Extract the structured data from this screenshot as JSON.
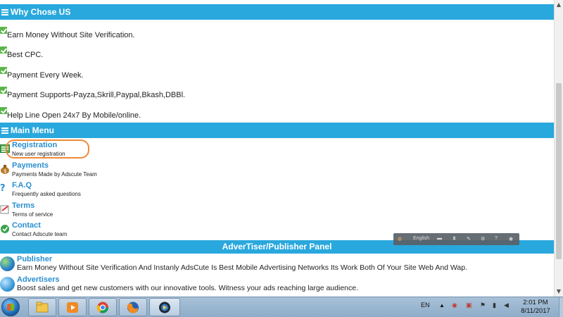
{
  "why_section": {
    "title": "Why Chose US",
    "items": [
      "Earn Money Without Site Verification.",
      "Best CPC.",
      "Payment Every Week.",
      "Payment Supports-Payza,Skrill,Paypal,Bkash,DBBl.",
      "Help Line Open 24x7 By Mobile/online."
    ]
  },
  "main_menu": {
    "title": "Main Menu",
    "items": [
      {
        "title": "Registration",
        "subtitle": "New user registration",
        "icon": "registration-icon"
      },
      {
        "title": "Payments",
        "subtitle": "Payments Made by Adscute Team",
        "icon": "money-bag-icon"
      },
      {
        "title": "F.A.Q",
        "subtitle": "Frequently asked questions",
        "icon": "question-icon"
      },
      {
        "title": "Terms",
        "subtitle": "Terms of service",
        "icon": "terms-icon"
      },
      {
        "title": "Contact",
        "subtitle": "Contact Adscute team",
        "icon": "contact-icon"
      }
    ]
  },
  "panel": {
    "title": "AdverTiser/Publisher Panel",
    "items": [
      {
        "title": "Publisher",
        "subtitle": "Earn Money Without Site Verification And Instanly AdsCute Is Best Mobile Advertising Networks Its Work Both Of Your Site Web And Wap.",
        "icon": "globe-icon"
      },
      {
        "title": "Advertisers",
        "subtitle": "Boost sales and get new customers with our innovative tools. Witness your ads reaching large audience.",
        "icon": "advertisers-icon"
      }
    ]
  },
  "language_bar": {
    "label": "English"
  },
  "taskbar": {
    "apps": [
      "file-explorer-icon",
      "media-player-icon",
      "chrome-icon",
      "firefox-icon",
      "media-center-icon"
    ],
    "language": "EN",
    "time": "2:01 PM",
    "date": "8/11/2017"
  },
  "colors": {
    "header_bar": "#29a8dd",
    "link": "#2a8fd0",
    "check": "#5cb54a",
    "highlight_circle": "#f0883a"
  }
}
